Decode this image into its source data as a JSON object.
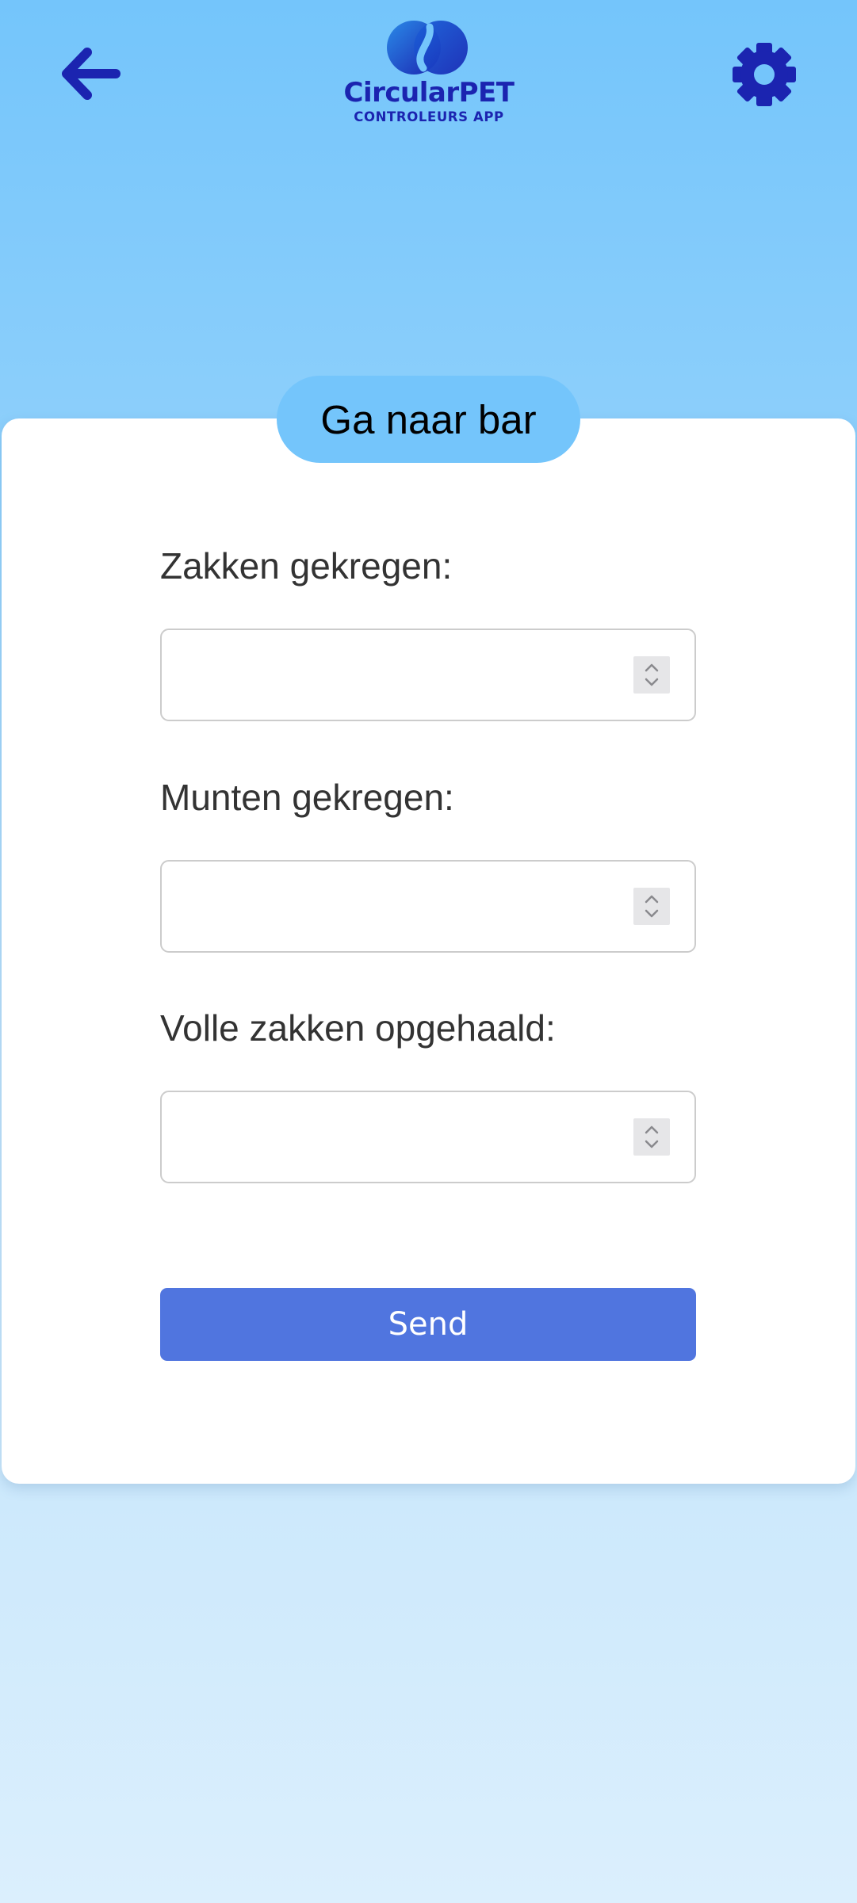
{
  "header": {
    "back_icon": "arrow-left-icon",
    "settings_icon": "gear-icon",
    "logo": {
      "title": "CircularPET",
      "subtitle": "CONTROLEURS APP"
    }
  },
  "card": {
    "title": "Ga naar bar",
    "fields": [
      {
        "label": "Zakken gekregen:",
        "value": ""
      },
      {
        "label": "Munten gekregen:",
        "value": ""
      },
      {
        "label": "Volle zakken opgehaald:",
        "value": ""
      }
    ],
    "send_label": "Send"
  },
  "colors": {
    "brand_blue": "#1b24b0",
    "accent_sky": "#74c5fb",
    "button_blue": "#5075df"
  }
}
